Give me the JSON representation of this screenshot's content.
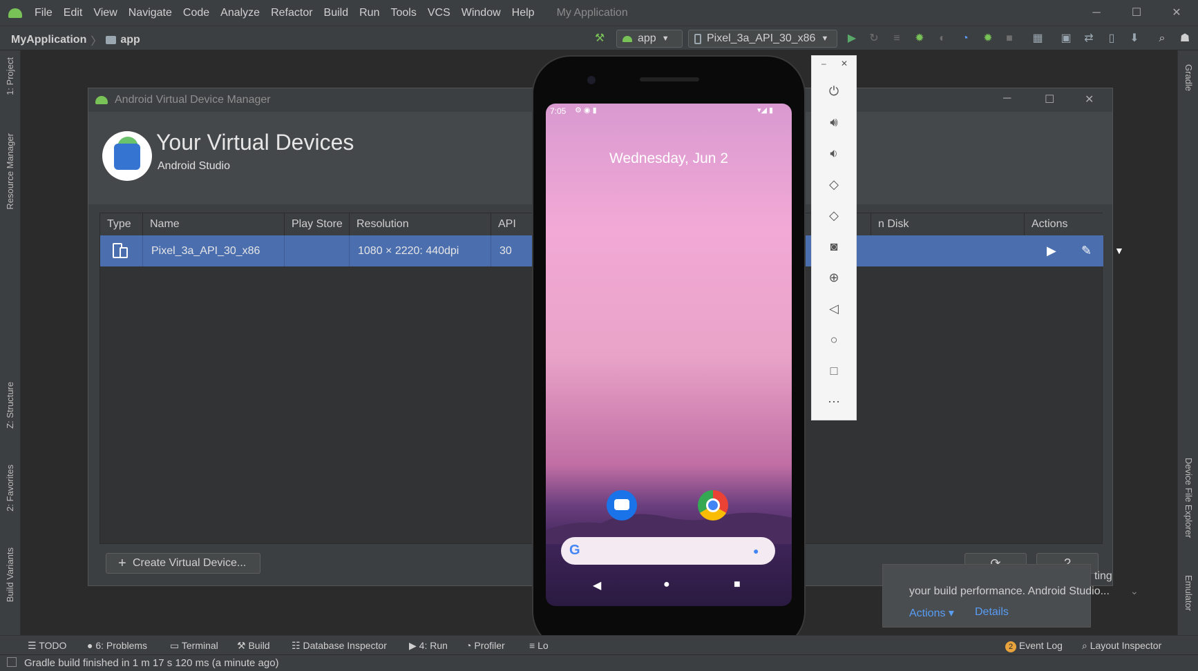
{
  "menu": {
    "items": [
      "File",
      "Edit",
      "View",
      "Navigate",
      "Code",
      "Analyze",
      "Refactor",
      "Build",
      "Run",
      "Tools",
      "VCS",
      "Window",
      "Help"
    ],
    "app_title": "My Application"
  },
  "toolbar": {
    "project": "MyApplication",
    "module": "app",
    "config": "app",
    "device": "Pixel_3a_API_30_x86"
  },
  "left_tabs": [
    "1: Project",
    "Resource Manager",
    "Z: Structure",
    "2: Favorites",
    "Build Variants"
  ],
  "right_tabs": [
    "Gradle",
    "Device File Explorer",
    "Emulator"
  ],
  "avd": {
    "window_title": "Android Virtual Device Manager",
    "heading": "Your Virtual Devices",
    "subheading": "Android Studio",
    "columns": [
      "Type",
      "Name",
      "Play Store",
      "Resolution",
      "API",
      "n Disk",
      "Actions"
    ],
    "row": {
      "name": "Pixel_3a_API_30_x86",
      "resolution": "1080 × 2220: 440dpi",
      "api": "30"
    },
    "create_button": "Create Virtual Device...",
    "help_button": "?"
  },
  "notification": {
    "partial": "ting",
    "text": "your build performance. Android Studio...",
    "action1": "Actions ▾",
    "action2": "Details"
  },
  "phone": {
    "time": "7:05",
    "date": "Wednesday, Jun 2"
  },
  "bottom_tabs": [
    "TODO",
    "6: Problems",
    "Terminal",
    "Build",
    "Database Inspector",
    "4: Run",
    "Profiler",
    "Lo"
  ],
  "bottom_right": {
    "event_count": "2",
    "event_log": "Event Log",
    "layout_inspector": "Layout Inspector"
  },
  "status": "Gradle build finished in 1 m 17 s 120 ms (a minute ago)",
  "colors": {
    "accent": "#4b6eaf",
    "android_green": "#78c257",
    "link": "#589df6"
  }
}
